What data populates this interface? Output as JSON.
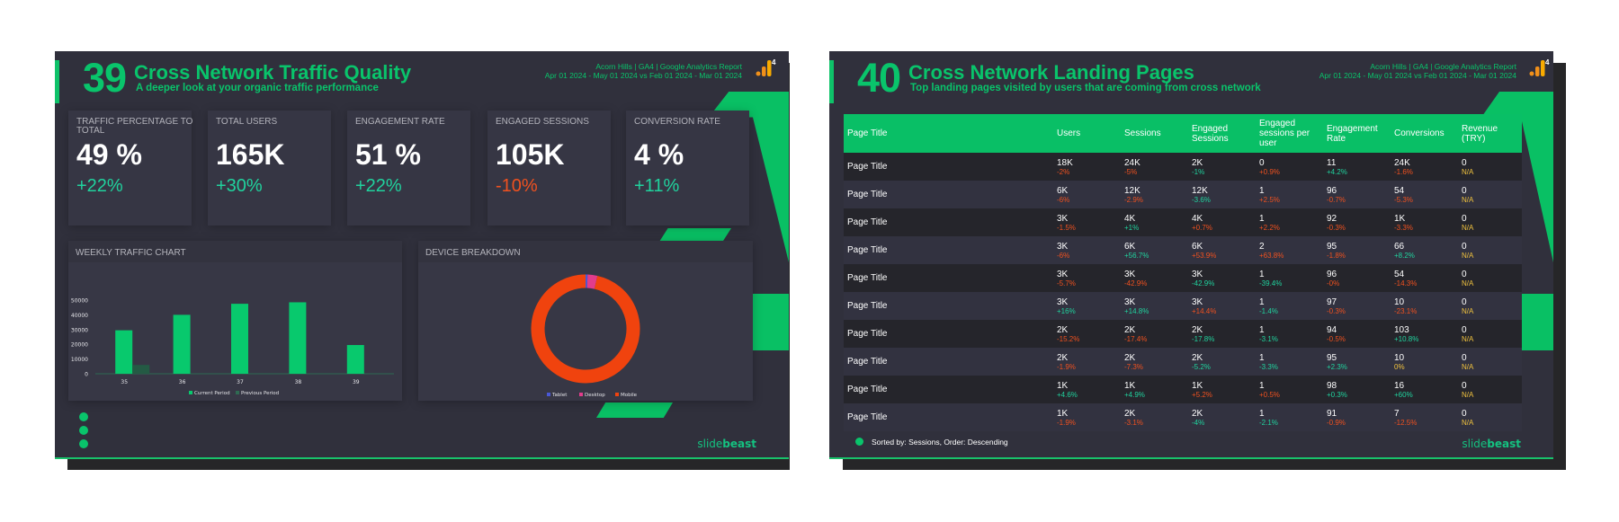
{
  "slides": [
    {
      "number": "39",
      "title": "Cross Network Traffic Quality",
      "subtitle": "A deeper look at your organic traffic performance",
      "meta_line1": "Acorn Hills | GA4 | Google Analytics Report",
      "meta_line2": "Apr 01 2024 - May 01 2024 vs Feb 01 2024 - Mar 01 2024",
      "badge": "4",
      "kpis": [
        {
          "label": "TRAFFIC PERCENTAGE TO TOTAL",
          "value": "49 %",
          "change": "+22%",
          "trend": "pos"
        },
        {
          "label": "TOTAL USERS",
          "value": "165K",
          "change": "+30%",
          "trend": "pos"
        },
        {
          "label": "ENGAGEMENT RATE",
          "value": "51 %",
          "change": "+22%",
          "trend": "pos"
        },
        {
          "label": "ENGAGED SESSIONS",
          "value": "105K",
          "change": "-10%",
          "trend": "neg"
        },
        {
          "label": "CONVERSION RATE",
          "value": "4 %",
          "change": "+11%",
          "trend": "pos"
        }
      ],
      "brand_light": "slide",
      "brand_bold": "beast"
    },
    {
      "number": "40",
      "title": "Cross Network Landing Pages",
      "subtitle": "Top landing pages visited by users that are coming from cross network",
      "meta_line1": "Acorn Hills | GA4 | Google Analytics Report",
      "meta_line2": "Apr 01 2024 - May 01 2024 vs Feb 01 2024 - Mar 01 2024",
      "badge": "4",
      "sort_note": "Sorted by: Sessions, Order: Descending",
      "brand_light": "slide",
      "brand_bold": "beast"
    }
  ],
  "colors": {
    "accent": "#09c46b",
    "positive": "#20d39e",
    "negative": "#f0511f",
    "neutral": "#f0c23e",
    "slide_bg": "#30303c"
  },
  "landing_table": {
    "columns": [
      "Page Title",
      "Users",
      "Sessions",
      "Engaged Sessions",
      "Engaged sessions per user",
      "Engagement Rate",
      "Conversions",
      "Revenue (TRY)"
    ],
    "rows": [
      {
        "page": "Page Title",
        "cells": [
          [
            "18K",
            "-2%",
            "neg"
          ],
          [
            "24K",
            "-5%",
            "neg"
          ],
          [
            "2K",
            "-1%",
            "pos"
          ],
          [
            "0",
            "+0.9%",
            "neg"
          ],
          [
            "11",
            "+4.2%",
            "pos"
          ],
          [
            "24K",
            "-1.6%",
            "neg"
          ],
          [
            "0",
            "N/A",
            "neu"
          ]
        ]
      },
      {
        "page": "Page Title",
        "cells": [
          [
            "6K",
            "-6%",
            "neg"
          ],
          [
            "12K",
            "-2.9%",
            "neg"
          ],
          [
            "12K",
            "-3.6%",
            "pos"
          ],
          [
            "1",
            "+2.5%",
            "neg"
          ],
          [
            "96",
            "-0.7%",
            "neg"
          ],
          [
            "54",
            "-5.3%",
            "neg"
          ],
          [
            "0",
            "N/A",
            "neu"
          ]
        ]
      },
      {
        "page": "Page Title",
        "cells": [
          [
            "3K",
            "-1.5%",
            "neg"
          ],
          [
            "4K",
            "+1%",
            "pos"
          ],
          [
            "4K",
            "+0.7%",
            "neg"
          ],
          [
            "1",
            "+2.2%",
            "neg"
          ],
          [
            "92",
            "-0.3%",
            "neg"
          ],
          [
            "1K",
            "-3.3%",
            "neg"
          ],
          [
            "0",
            "N/A",
            "neu"
          ]
        ]
      },
      {
        "page": "Page Title",
        "cells": [
          [
            "3K",
            "-6%",
            "neg"
          ],
          [
            "6K",
            "+56.7%",
            "pos"
          ],
          [
            "6K",
            "+53.9%",
            "neg"
          ],
          [
            "2",
            "+63.8%",
            "neg"
          ],
          [
            "95",
            "-1.8%",
            "neg"
          ],
          [
            "66",
            "+8.2%",
            "pos"
          ],
          [
            "0",
            "N/A",
            "neu"
          ]
        ]
      },
      {
        "page": "Page Title",
        "cells": [
          [
            "3K",
            "-5.7%",
            "neg"
          ],
          [
            "3K",
            "-42.9%",
            "neg"
          ],
          [
            "3K",
            "-42.9%",
            "pos"
          ],
          [
            "1",
            "-39.4%",
            "pos"
          ],
          [
            "96",
            "-0%",
            "neg"
          ],
          [
            "54",
            "-14.3%",
            "neg"
          ],
          [
            "0",
            "N/A",
            "neu"
          ]
        ]
      },
      {
        "page": "Page Title",
        "cells": [
          [
            "3K",
            "+16%",
            "pos"
          ],
          [
            "3K",
            "+14.8%",
            "pos"
          ],
          [
            "3K",
            "+14.4%",
            "neg"
          ],
          [
            "1",
            "-1.4%",
            "pos"
          ],
          [
            "97",
            "-0.3%",
            "neg"
          ],
          [
            "10",
            "-23.1%",
            "neg"
          ],
          [
            "0",
            "N/A",
            "neu"
          ]
        ]
      },
      {
        "page": "Page Title",
        "cells": [
          [
            "2K",
            "-15.2%",
            "neg"
          ],
          [
            "2K",
            "-17.4%",
            "neg"
          ],
          [
            "2K",
            "-17.8%",
            "pos"
          ],
          [
            "1",
            "-3.1%",
            "pos"
          ],
          [
            "94",
            "-0.5%",
            "neg"
          ],
          [
            "103",
            "+10.8%",
            "pos"
          ],
          [
            "0",
            "N/A",
            "neu"
          ]
        ]
      },
      {
        "page": "Page Title",
        "cells": [
          [
            "2K",
            "-1.9%",
            "neg"
          ],
          [
            "2K",
            "-7.3%",
            "neg"
          ],
          [
            "2K",
            "-5.2%",
            "pos"
          ],
          [
            "1",
            "-3.3%",
            "pos"
          ],
          [
            "95",
            "+2.3%",
            "pos"
          ],
          [
            "10",
            "0%",
            "neu"
          ],
          [
            "0",
            "N/A",
            "neu"
          ]
        ]
      },
      {
        "page": "Page Title",
        "cells": [
          [
            "1K",
            "+4.6%",
            "pos"
          ],
          [
            "1K",
            "+4.9%",
            "pos"
          ],
          [
            "1K",
            "+5.2%",
            "neg"
          ],
          [
            "1",
            "+0.5%",
            "neg"
          ],
          [
            "98",
            "+0.3%",
            "pos"
          ],
          [
            "16",
            "+60%",
            "pos"
          ],
          [
            "0",
            "N/A",
            "neu"
          ]
        ]
      },
      {
        "page": "Page Title",
        "cells": [
          [
            "1K",
            "-1.9%",
            "neg"
          ],
          [
            "2K",
            "-3.1%",
            "neg"
          ],
          [
            "2K",
            "-4%",
            "pos"
          ],
          [
            "1",
            "-2.1%",
            "pos"
          ],
          [
            "91",
            "-0.9%",
            "neg"
          ],
          [
            "7",
            "-12.5%",
            "neg"
          ],
          [
            "0",
            "N/A",
            "neu"
          ]
        ]
      }
    ]
  },
  "chart_data": [
    {
      "type": "bar",
      "title": "WEEKLY TRAFFIC CHART",
      "xlabel": "",
      "ylabel": "",
      "categories": [
        "35",
        "36",
        "37",
        "38",
        "39"
      ],
      "series": [
        {
          "name": "Current Period",
          "color": "#08c96d",
          "values": [
            29500,
            40000,
            47500,
            48500,
            19500
          ]
        },
        {
          "name": "Previous Period",
          "color": "#245a44",
          "values": [
            6000,
            0,
            0,
            0,
            0
          ]
        }
      ],
      "ylim": [
        0,
        50000
      ],
      "yticks": [
        0,
        10000,
        20000,
        30000,
        40000,
        50000
      ],
      "grid": false,
      "legend": "bottom"
    },
    {
      "type": "pie",
      "title": "DEVICE BREAKDOWN",
      "donut": true,
      "categories": [
        "Tablet",
        "Desktop",
        "Mobile"
      ],
      "colors": [
        "#4a58d6",
        "#e23c8c",
        "#f0430e"
      ],
      "values": [
        0.6,
        2.9,
        96.5
      ],
      "legend": "bottom"
    }
  ]
}
